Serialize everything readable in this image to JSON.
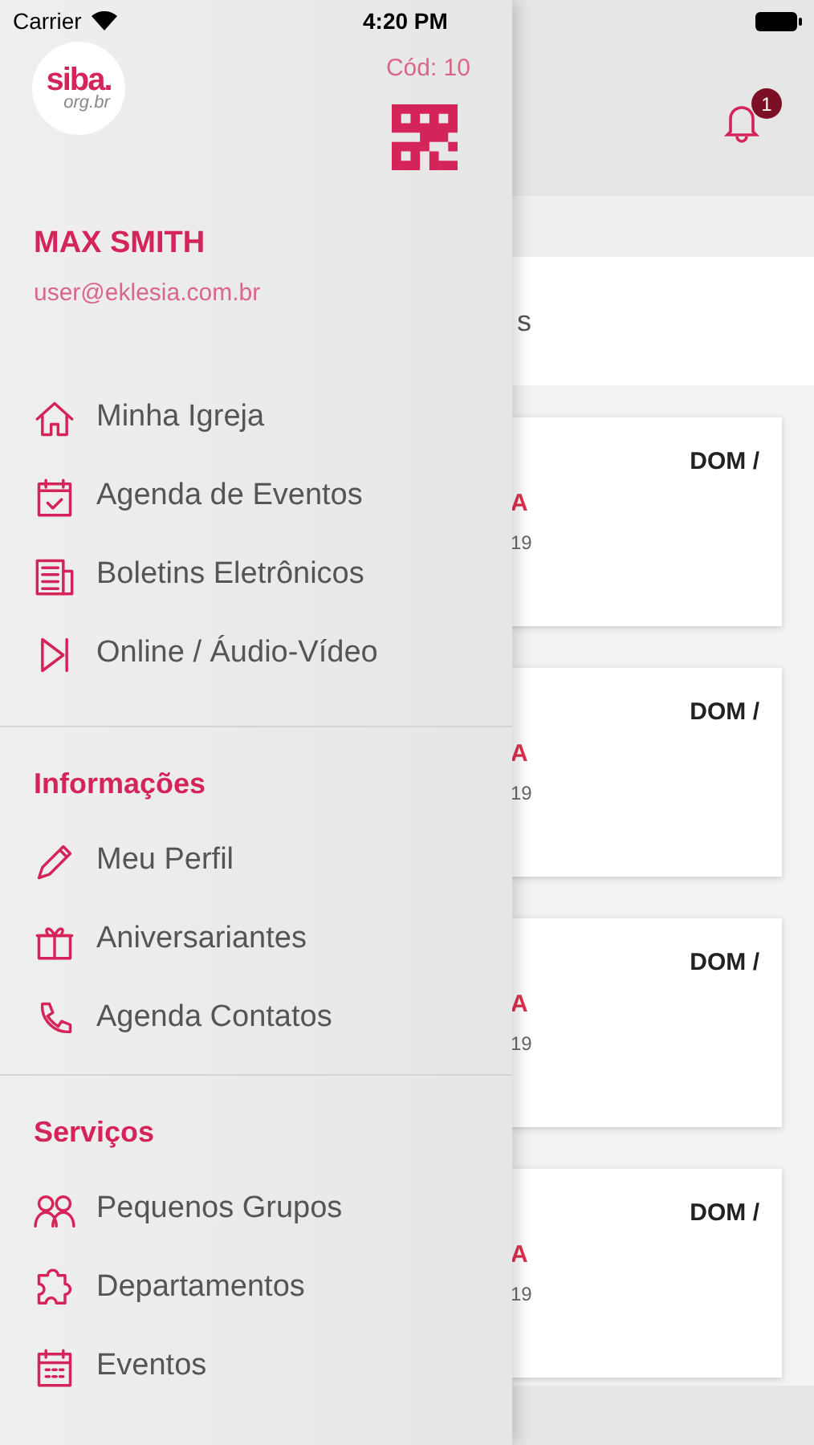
{
  "status_bar": {
    "carrier": "Carrier",
    "time": "4:20 PM"
  },
  "header": {
    "notification_count": "1"
  },
  "search_area": {
    "text": "s"
  },
  "cards": [
    {
      "day": "DOM /",
      "title_fragment": "A",
      "date_fragment": "19"
    },
    {
      "day": "DOM /",
      "title_fragment": "A",
      "date_fragment": "19"
    },
    {
      "day": "DOM /",
      "title_fragment": "A",
      "date_fragment": "19"
    },
    {
      "day": "DOM /",
      "title_fragment": "A",
      "date_fragment": "19"
    }
  ],
  "drawer": {
    "logo_text": "siba.",
    "logo_domain": "org.br",
    "code": "Cód: 10",
    "user_name": "MAX SMITH",
    "email": "user@eklesia.com.br",
    "sections": [
      {
        "items": [
          "Minha Igreja",
          "Agenda de Eventos",
          "Boletins Eletrônicos",
          "Online / Áudio-Vídeo"
        ]
      },
      {
        "title": "Informações",
        "items": [
          "Meu Perfil",
          "Aniversariantes",
          "Agenda Contatos"
        ]
      },
      {
        "title": "Serviços",
        "items": [
          "Pequenos Grupos",
          "Departamentos",
          "Eventos"
        ]
      }
    ]
  }
}
